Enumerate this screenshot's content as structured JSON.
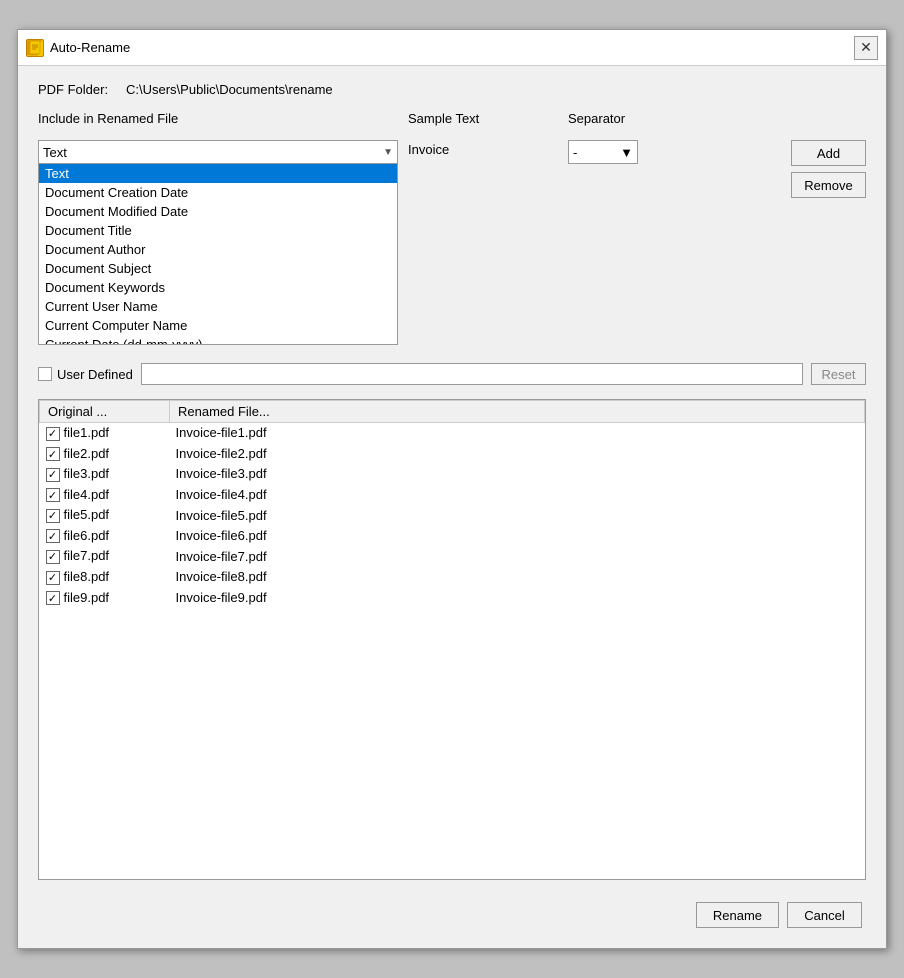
{
  "window": {
    "title": "Auto-Rename",
    "icon": "AR"
  },
  "pdf_folder": {
    "label": "PDF Folder:",
    "path": "C:\\Users\\Public\\Documents\\rename"
  },
  "include_section": {
    "label": "Include in Renamed File",
    "sample_label": "Sample Text",
    "separator_label": "Separator"
  },
  "dropdown": {
    "selected": "Text",
    "options": [
      "Text",
      "Document Creation Date",
      "Document Modified Date",
      "Document Title",
      "Document Author",
      "Document Subject",
      "Document Keywords",
      "Current User Name",
      "Current Computer Name",
      "Current Date (dd-mm-yyyy)"
    ]
  },
  "sample_text": {
    "value": "Invoice"
  },
  "separator": {
    "value": "-",
    "options": [
      "-",
      "_",
      " ",
      ".",
      ","
    ]
  },
  "buttons": {
    "add": "Add",
    "remove": "Remove",
    "reset": "Reset",
    "rename": "Rename",
    "cancel": "Cancel"
  },
  "user_defined": {
    "label": "User Defined",
    "value": "",
    "placeholder": ""
  },
  "file_table": {
    "columns": [
      "Original ...",
      "Renamed File..."
    ],
    "rows": [
      {
        "checked": true,
        "original": "file1.pdf",
        "renamed": "Invoice-file1.pdf"
      },
      {
        "checked": true,
        "original": "file2.pdf",
        "renamed": "Invoice-file2.pdf"
      },
      {
        "checked": true,
        "original": "file3.pdf",
        "renamed": "Invoice-file3.pdf"
      },
      {
        "checked": true,
        "original": "file4.pdf",
        "renamed": "Invoice-file4.pdf"
      },
      {
        "checked": true,
        "original": "file5.pdf",
        "renamed": "Invoice-file5.pdf"
      },
      {
        "checked": true,
        "original": "file6.pdf",
        "renamed": "Invoice-file6.pdf"
      },
      {
        "checked": true,
        "original": "file7.pdf",
        "renamed": "Invoice-file7.pdf"
      },
      {
        "checked": true,
        "original": "file8.pdf",
        "renamed": "Invoice-file8.pdf"
      },
      {
        "checked": true,
        "original": "file9.pdf",
        "renamed": "Invoice-file9.pdf"
      }
    ]
  }
}
